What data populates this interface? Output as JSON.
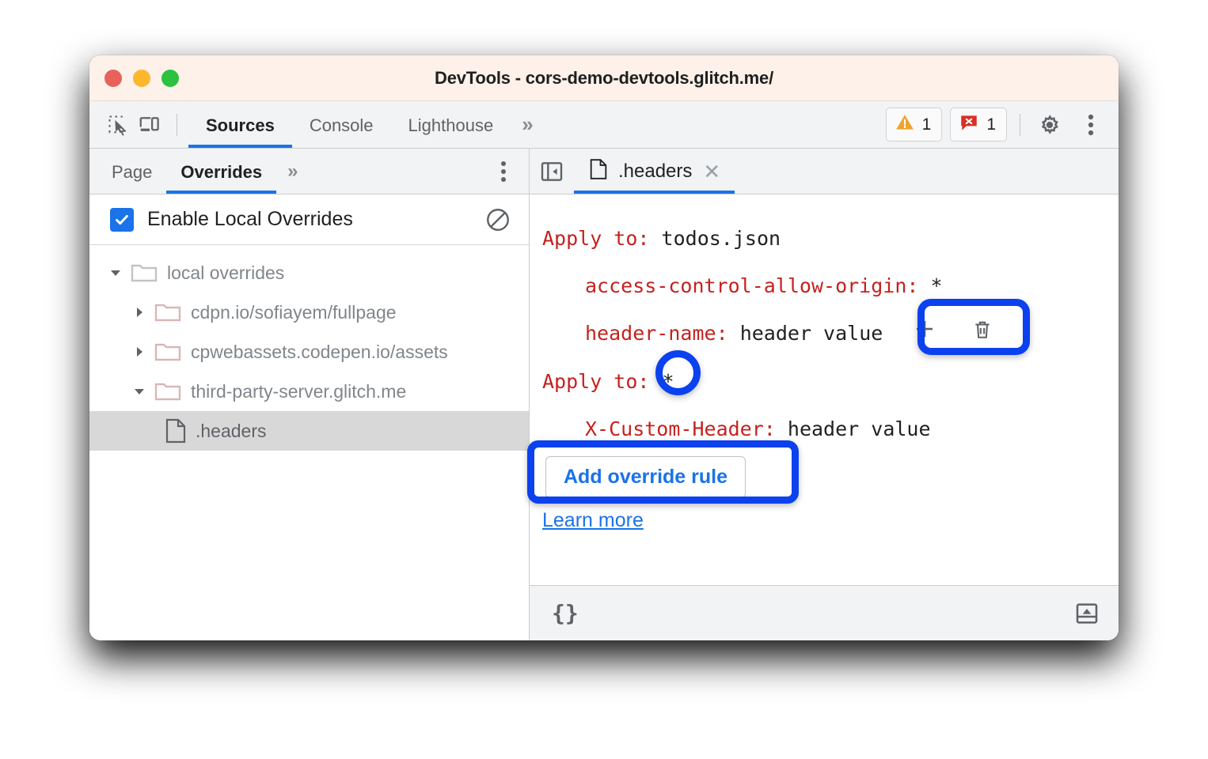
{
  "window": {
    "title": "DevTools - cors-demo-devtools.glitch.me/",
    "traffic_lights": [
      "close",
      "minimize",
      "zoom"
    ]
  },
  "toolbar": {
    "icons": [
      {
        "name": "inspect-element-icon",
        "label": "Inspect element"
      },
      {
        "name": "device-toolbar-icon",
        "label": "Toggle device toolbar"
      }
    ],
    "panels": [
      {
        "label": "Sources",
        "active": true
      },
      {
        "label": "Console",
        "active": false
      },
      {
        "label": "Lighthouse",
        "active": false
      }
    ],
    "more_panels": "»",
    "warning_count": "1",
    "error_count": "1",
    "settings_label": "Settings",
    "more_options_label": "Customize and control DevTools"
  },
  "navigator": {
    "tabs": [
      {
        "label": "Page",
        "active": false
      },
      {
        "label": "Overrides",
        "active": true
      }
    ],
    "more_tabs": "»",
    "more_options_label": "More options",
    "enable_overrides": {
      "label": "Enable Local Overrides",
      "checked": true,
      "clear_label": "Clear configuration"
    },
    "tree": [
      {
        "label": "local overrides",
        "type": "folder",
        "depth": 0,
        "expanded": true,
        "selected": false
      },
      {
        "label": "cdpn.io/sofiayem/fullpage",
        "type": "folder",
        "depth": 1,
        "expanded": false,
        "selected": false
      },
      {
        "label": "cpwebassets.codepen.io/assets",
        "type": "folder",
        "depth": 1,
        "expanded": false,
        "selected": false
      },
      {
        "label": "third-party-server.glitch.me",
        "type": "folder",
        "depth": 1,
        "expanded": true,
        "selected": false
      },
      {
        "label": ".headers",
        "type": "file",
        "depth": 2,
        "expanded": null,
        "selected": true
      }
    ]
  },
  "editor": {
    "collapse_label": "Hide navigator",
    "tab": {
      "name": ".headers",
      "close_label": "Close"
    },
    "headers_rules": [
      {
        "apply_to_label": "Apply to",
        "apply_to_value": "todos.json",
        "headers": [
          {
            "name": "access-control-allow-origin",
            "value": "*",
            "highlighted": false
          },
          {
            "name": "header-name",
            "value": "header value",
            "highlighted": true
          }
        ]
      },
      {
        "apply_to_label": "Apply to",
        "apply_to_value": "*",
        "headers": [
          {
            "name": "X-Custom-Header",
            "value": "header value",
            "highlighted": false
          }
        ]
      }
    ],
    "row_actions": {
      "add_label": "+",
      "delete_label": "Delete"
    },
    "add_rule_button": "Add override rule",
    "learn_more": "Learn more"
  },
  "status_bar": {
    "pretty_print": "{}",
    "drawer_toggle_label": "Show console drawer"
  },
  "annotations": {
    "accent_color": "#0b41ee",
    "rings": [
      {
        "name": "add-delete-header-buttons"
      },
      {
        "name": "apply-to-wildcard-value"
      },
      {
        "name": "add-override-rule-button"
      }
    ]
  },
  "colors": {
    "titlebar_bg": "#fdf1ea",
    "toolbar_bg": "#f1f3f4",
    "accent_blue": "#1a73e8",
    "header_key_red": "#c5221f",
    "selection_gray": "#d8d8d8",
    "folder_rose": "#d9b7b7"
  }
}
